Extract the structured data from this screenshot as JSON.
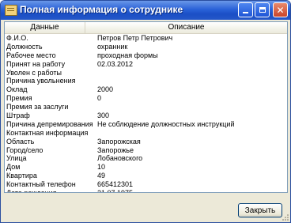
{
  "window": {
    "title": "Полная информация о сотруднике"
  },
  "grid": {
    "headers": [
      "Данные",
      "Описание"
    ],
    "rows": [
      {
        "field": "Ф.И.О.",
        "value": "Петров Петр Петрович"
      },
      {
        "field": "Должность",
        "value": "охранник"
      },
      {
        "field": "Рабочее место",
        "value": "проходная формы"
      },
      {
        "field": "Принят на работу",
        "value": "02.03.2012"
      },
      {
        "field": "Уволен с работы",
        "value": ""
      },
      {
        "field": "Причина увольнения",
        "value": ""
      },
      {
        "field": "Оклад",
        "value": "2000"
      },
      {
        "field": "Премия",
        "value": "0"
      },
      {
        "field": "Премия за заслуги",
        "value": ""
      },
      {
        "field": "Штраф",
        "value": "300"
      },
      {
        "field": "Причина депремирования",
        "value": "Не соблюдение должностных инструкций"
      },
      {
        "field": "Контактная информация",
        "value": ""
      },
      {
        "field": "Область",
        "value": "Запорожская"
      },
      {
        "field": "Город/село",
        "value": "Запорожье"
      },
      {
        "field": "Улица",
        "value": "Лобановского"
      },
      {
        "field": "Дом",
        "value": "10"
      },
      {
        "field": "Квартира",
        "value": "49"
      },
      {
        "field": "Контактный телефон",
        "value": "665412301"
      },
      {
        "field": "Дата рождения",
        "value": "21.07.1975"
      }
    ]
  },
  "buttons": {
    "close_label": "Закрыть"
  },
  "icons": {
    "app": "document-icon",
    "minimize": "minimize-icon",
    "maximize": "maximize-icon",
    "close": "close-icon"
  },
  "colors": {
    "titlebar": "#2a62d8",
    "window_bg": "#ece9d8",
    "close_red": "#c9452a"
  }
}
